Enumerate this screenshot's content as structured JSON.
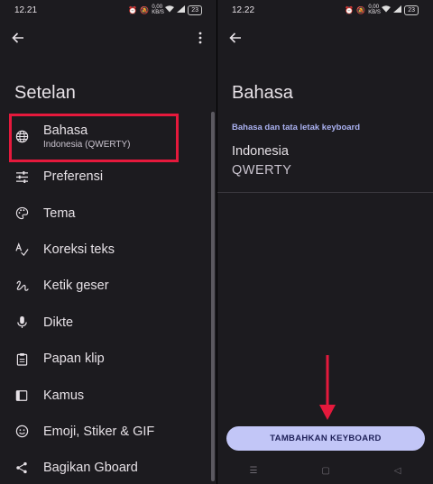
{
  "left_screen": {
    "status_bar": {
      "time": "12.21",
      "net_speed": "0,00 KB/S",
      "battery": "23"
    },
    "title": "Setelan",
    "menu": [
      {
        "label": "Bahasa",
        "subtitle": "Indonesia (QWERTY)",
        "icon": "globe-icon"
      },
      {
        "label": "Preferensi",
        "icon": "tune-icon"
      },
      {
        "label": "Tema",
        "icon": "palette-icon"
      },
      {
        "label": "Koreksi teks",
        "icon": "spellcheck-icon"
      },
      {
        "label": "Ketik geser",
        "icon": "gesture-icon"
      },
      {
        "label": "Dikte",
        "icon": "mic-icon"
      },
      {
        "label": "Papan klip",
        "icon": "clipboard-icon"
      },
      {
        "label": "Kamus",
        "icon": "dictionary-icon"
      },
      {
        "label": "Emoji, Stiker & GIF",
        "icon": "emoji-icon"
      },
      {
        "label": "Bagikan Gboard",
        "icon": "share-icon"
      }
    ]
  },
  "right_screen": {
    "status_bar": {
      "time": "12.22",
      "net_speed": "0,00 KB/S",
      "battery": "23"
    },
    "title": "Bahasa",
    "section_label": "Bahasa dan tata letak keyboard",
    "language": {
      "name": "Indonesia",
      "layout": "QWERTY"
    },
    "add_button": "TAMBAHKAN KEYBOARD"
  },
  "colors": {
    "background": "#1c1b1f",
    "highlight": "#e5193c",
    "accent": "#aab1f0",
    "button": "#c2c6f7"
  }
}
